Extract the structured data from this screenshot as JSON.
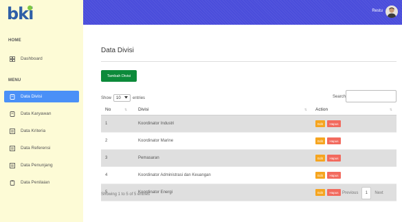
{
  "brand": {
    "logo": "bki"
  },
  "sidebar": {
    "sections": [
      "HOME",
      "MENU"
    ],
    "items": [
      {
        "label": "Dashboard",
        "icon": "dashboard-icon"
      },
      {
        "label": "Data Divisi",
        "icon": "file-icon",
        "active": true
      },
      {
        "label": "Data Karyawan",
        "icon": "file-icon"
      },
      {
        "label": "Data Kriteria",
        "icon": "list-icon"
      },
      {
        "label": "Data Referensi",
        "icon": "list-icon"
      },
      {
        "label": "Data Penunjang",
        "icon": "list-icon"
      },
      {
        "label": "Data Penilaian",
        "icon": "clipboard-icon"
      }
    ]
  },
  "header": {
    "user_name": "Restu",
    "accent": "#4a4ddb"
  },
  "main": {
    "title": "Data Divisi",
    "add_button": "Tambah Divisi",
    "show_prefix": "Show",
    "show_value": "10",
    "show_suffix": "entries",
    "search_label": "Search:",
    "search_value": "",
    "columns": [
      "No",
      "Divisi",
      "Action"
    ],
    "rows": [
      {
        "no": "1",
        "divisi": "Koordinator Industri"
      },
      {
        "no": "2",
        "divisi": "Koordinator Marine"
      },
      {
        "no": "3",
        "divisi": "Pemasaran"
      },
      {
        "no": "4",
        "divisi": "Koordinator Administrasi dan Keuangan"
      },
      {
        "no": "5",
        "divisi": "Koordinator Energi"
      }
    ],
    "edit_label": "Edit",
    "delete_label": "Hapus",
    "info": "Showing 1 to 5 of 5 entries",
    "pagination": {
      "previous": "Previous",
      "page": "1",
      "next": "Next"
    }
  },
  "colors": {
    "sidebar_bg": "#fdfbd6",
    "active_item": "#4a90f7",
    "add_button": "#0c8a3a",
    "edit": "#f6a51f",
    "delete": "#f26a5e"
  }
}
